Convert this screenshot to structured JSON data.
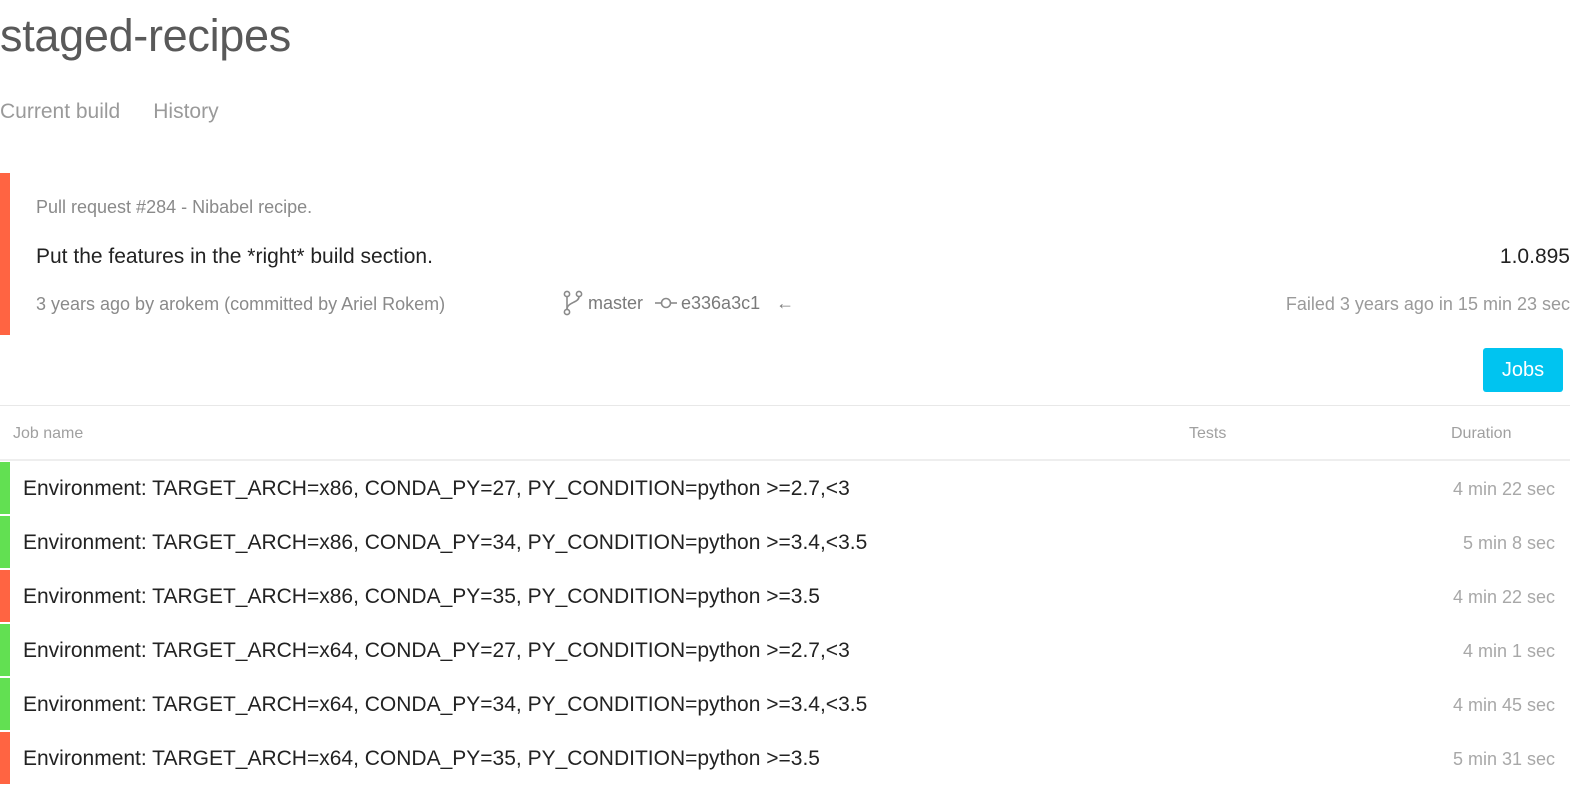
{
  "repo": {
    "title": "staged-recipes"
  },
  "tabs": [
    {
      "label": "Current build"
    },
    {
      "label": "History"
    }
  ],
  "build": {
    "status": "failed",
    "status_color": "#ff6442",
    "pull_request": "Pull request #284 - Nibabel recipe.",
    "commit_message": "Put the features in the *right* build section.",
    "version": "1.0.895",
    "author_line": "3 years ago by arokem (committed by Ariel Rokem)",
    "branch": "master",
    "branch_icon": "git-branch-icon",
    "commit": "e336a3c1",
    "commit_icon": "git-commit-icon",
    "compare_arrow": "←",
    "status_line": "Failed 3 years ago in 15 min 23 sec"
  },
  "jobs_button": {
    "label": "Jobs",
    "color": "#00c4f0"
  },
  "jobs_table": {
    "columns": {
      "name": "Job name",
      "tests": "Tests",
      "duration": "Duration"
    },
    "rows": [
      {
        "name": "Environment: TARGET_ARCH=x86, CONDA_PY=27, PY_CONDITION=python >=2.7,<3",
        "tests": "",
        "duration": "4 min 22 sec",
        "status": "success"
      },
      {
        "name": "Environment: TARGET_ARCH=x86, CONDA_PY=34, PY_CONDITION=python >=3.4,<3.5",
        "tests": "",
        "duration": "5 min 8 sec",
        "status": "success"
      },
      {
        "name": "Environment: TARGET_ARCH=x86, CONDA_PY=35, PY_CONDITION=python >=3.5",
        "tests": "",
        "duration": "4 min 22 sec",
        "status": "failed"
      },
      {
        "name": "Environment: TARGET_ARCH=x64, CONDA_PY=27, PY_CONDITION=python >=2.7,<3",
        "tests": "",
        "duration": "4 min 1 sec",
        "status": "success"
      },
      {
        "name": "Environment: TARGET_ARCH=x64, CONDA_PY=34, PY_CONDITION=python >=3.4,<3.5",
        "tests": "",
        "duration": "4 min 45 sec",
        "status": "success"
      },
      {
        "name": "Environment: TARGET_ARCH=x64, CONDA_PY=35, PY_CONDITION=python >=3.5",
        "tests": "",
        "duration": "5 min 31 sec",
        "status": "failed"
      }
    ]
  },
  "colors": {
    "success": "#62e052",
    "failed": "#ff6442"
  }
}
